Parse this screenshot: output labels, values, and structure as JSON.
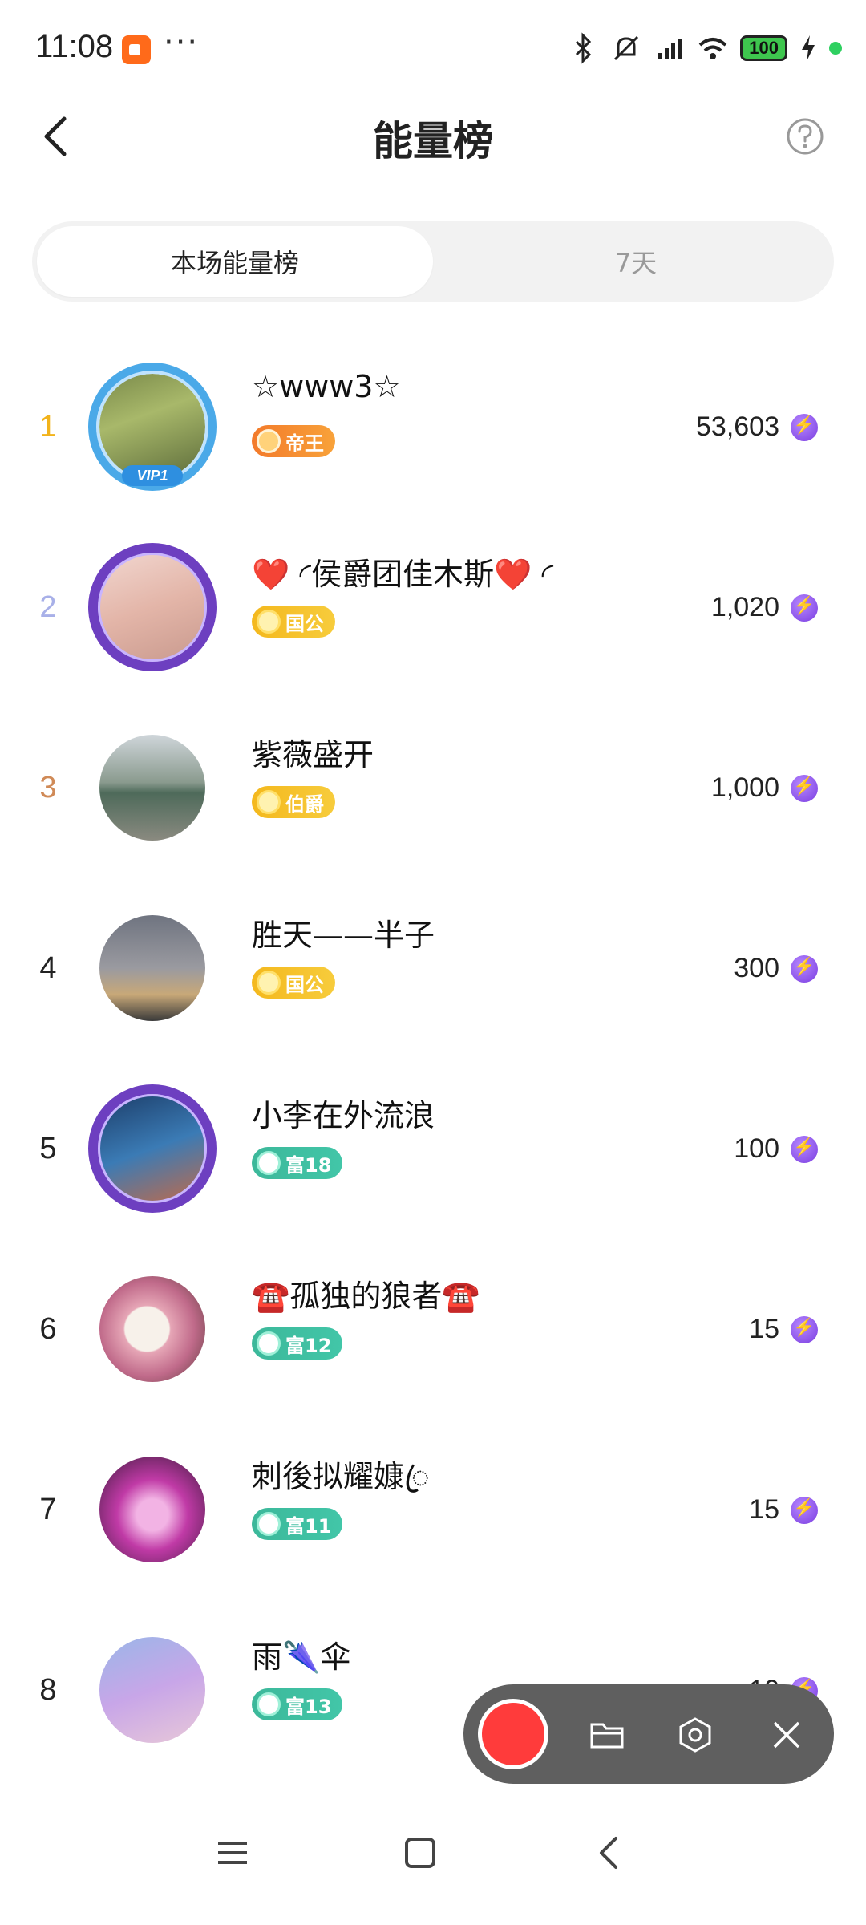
{
  "status_bar": {
    "time": "11:08",
    "dots": "···",
    "battery": "100"
  },
  "header": {
    "title": "能量榜"
  },
  "tabs": [
    {
      "label": "本场能量榜",
      "active": true
    },
    {
      "label": "7天",
      "active": false
    }
  ],
  "leaderboard": [
    {
      "rank": "1",
      "rank_color": "#f2b31b",
      "name": "☆www3☆",
      "badge": "帝王",
      "badge_style": "orange",
      "score": "53,603",
      "frame": "vip",
      "frame_tag": "VIP1"
    },
    {
      "rank": "2",
      "rank_color": "#a8b0e8",
      "name": "❤️ ◜侯爵团佳木斯❤️ ◜",
      "badge": "国公",
      "badge_style": "gold",
      "score": "1,020",
      "frame": "purple",
      "frame_tag": ""
    },
    {
      "rank": "3",
      "rank_color": "#d08a57",
      "name": "紫薇盛开",
      "badge": "伯爵",
      "badge_style": "gold",
      "score": "1,000",
      "frame": "none",
      "frame_tag": ""
    },
    {
      "rank": "4",
      "rank_color": "#222222",
      "name": "胜天——半子",
      "badge": "国公",
      "badge_style": "gold",
      "score": "300",
      "frame": "none",
      "frame_tag": ""
    },
    {
      "rank": "5",
      "rank_color": "#222222",
      "name": "小李在外流浪",
      "badge": "富18",
      "badge_style": "teal",
      "score": "100",
      "frame": "purple",
      "frame_tag": ""
    },
    {
      "rank": "6",
      "rank_color": "#222222",
      "name": "☎️孤独的狼者☎️",
      "badge": "富12",
      "badge_style": "teal",
      "score": "15",
      "frame": "none",
      "frame_tag": ""
    },
    {
      "rank": "7",
      "rank_color": "#222222",
      "name": "刺後拟耀嫝ꦿ",
      "badge": "富11",
      "badge_style": "teal",
      "score": "15",
      "frame": "none",
      "frame_tag": ""
    },
    {
      "rank": "8",
      "rank_color": "#222222",
      "name": "雨🌂伞",
      "badge": "富13",
      "badge_style": "teal",
      "score": "10",
      "frame": "none",
      "frame_tag": ""
    }
  ],
  "icons": {
    "back": "back-arrow-icon",
    "help": "help-icon",
    "energy": "lightning-icon",
    "recorder": [
      "record-icon",
      "folder-icon",
      "settings-icon",
      "close-icon"
    ],
    "nav": [
      "menu-icon",
      "home-icon",
      "back-icon"
    ]
  },
  "colors": {
    "accent_purple": "#7a3de0",
    "record_red": "#ff3b3b"
  }
}
